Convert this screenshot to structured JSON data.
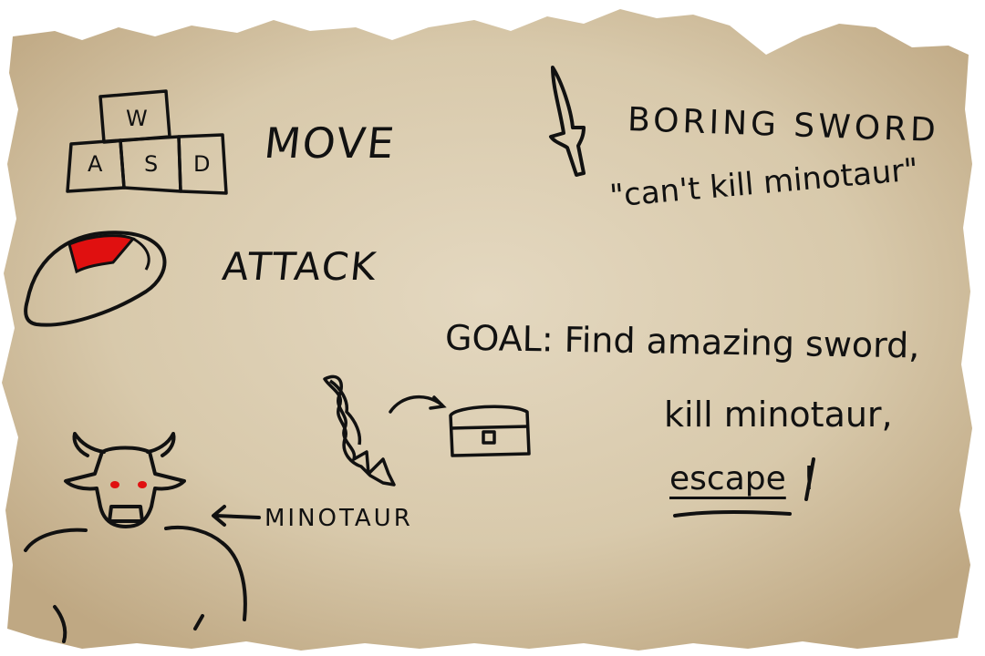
{
  "controls": {
    "move_label": "MOVE",
    "attack_label": "ATTACK",
    "keys": {
      "w": "W",
      "a": "A",
      "s": "S",
      "d": "D"
    }
  },
  "items": {
    "boring_sword_label": "BORING SWORD",
    "boring_sword_quote": "\"can't kill minotaur\""
  },
  "goal": {
    "line1": "GOAL: Find amazing sword,",
    "line2": "kill minotaur,",
    "line3_word": "escape",
    "line3_punct": "!"
  },
  "enemy": {
    "name": "MINOTAUR"
  },
  "colors": {
    "parchment": "#d9cbb0",
    "ink": "#111111",
    "mouse_button": "#e01010",
    "eyes": "#e01010"
  },
  "icons": [
    "wasd-keys-icon",
    "mouse-icon",
    "sword-icon",
    "amazing-sword-icon",
    "arrow-icon",
    "treasure-chest-icon",
    "minotaur-icon"
  ]
}
